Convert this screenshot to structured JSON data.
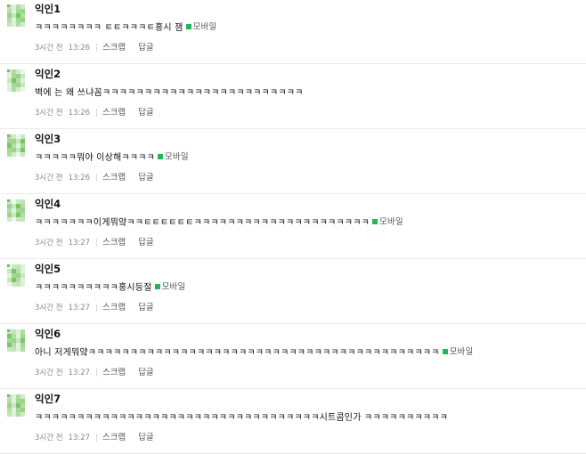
{
  "comments": [
    {
      "author": "익인1",
      "text": "ㅋㅋㅋㅋㅋㅋㅋㅋ ㅌㅌㅋㅋㅋㅌ홍시 잼",
      "mobile": true,
      "ago": "3시간 전",
      "time": "13:26",
      "scrap": "스크랩",
      "reply": "답글"
    },
    {
      "author": "익인2",
      "text": "벽에 는 왜 쓰냐꼼ㅋㅋㅋㅋㅋㅋㅋㅋㅋㅋㅋㅋㅋㅋㅋㅋㅋㅋㅋㅋㅋㅋㅋㅋ",
      "mobile": false,
      "ago": "3시간 전",
      "time": "13:26",
      "scrap": "스크랩",
      "reply": "답글"
    },
    {
      "author": "익인3",
      "text": "ㅋㅋㅋㅋㅋ뭐야 이상해ㅋㅋㅋㅋ",
      "mobile": true,
      "ago": "3시간 전",
      "time": "13:26",
      "scrap": "스크랩",
      "reply": "답글"
    },
    {
      "author": "익인4",
      "text": "ㅋㅋㅋㅋㅋㅋㅋ이게뭐얔ㅋㅋㅌㅌㅌㅌㅌㅌㅋㅋㅋㅋㅋㅋㅋㅋㅋㅋㅋㅋㅋㅋㅋㅋㅋㅋㅋㅋㅋ",
      "mobile": true,
      "ago": "3시간 전",
      "time": "13:27",
      "scrap": "스크랩",
      "reply": "답글"
    },
    {
      "author": "익인5",
      "text": "ㅋㅋㅋㅋㅋㅋㅋㅋㅋㅋ홍시등절",
      "mobile": true,
      "ago": "3시간 전",
      "time": "13:27",
      "scrap": "스크랩",
      "reply": "답글"
    },
    {
      "author": "익인6",
      "text": "아니 저게뭐얔ㅋㅋㅋㅋㅋㅋㅋㅋㅋㅋㅋㅋㅋㅋㅋㅋㅋㅋㅋㅋㅋㅋㅋㅋㅋㅋㅋㅋㅋㅋㅋㅋㅋㅋㅋㅋㅋㅋㅋㅋㅋㅋ",
      "mobile": true,
      "ago": "3시간 전",
      "time": "13:27",
      "scrap": "스크랩",
      "reply": "답글"
    },
    {
      "author": "익인7",
      "text": "ㅋㅋㅋㅋㅋㅋㅋㅋㅋㅋㅋㅋㅋㅋㅋㅋㅋㅋㅋㅋㅋㅋㅋㅋㅋㅋㅋㅋㅋㅋㅋㅋㅋㅋ시트콤인가 ㅋㅋㅋㅋㅋㅋㅋㅋㅋㅋ",
      "mobile": false,
      "ago": "3시간 전",
      "time": "13:27",
      "scrap": "스크랩",
      "reply": "답글"
    }
  ],
  "mobile_label": "모바일",
  "colors": {
    "accent": "#1db954",
    "avatar_green": "#8bc97a",
    "meta_gray": "#888888"
  }
}
